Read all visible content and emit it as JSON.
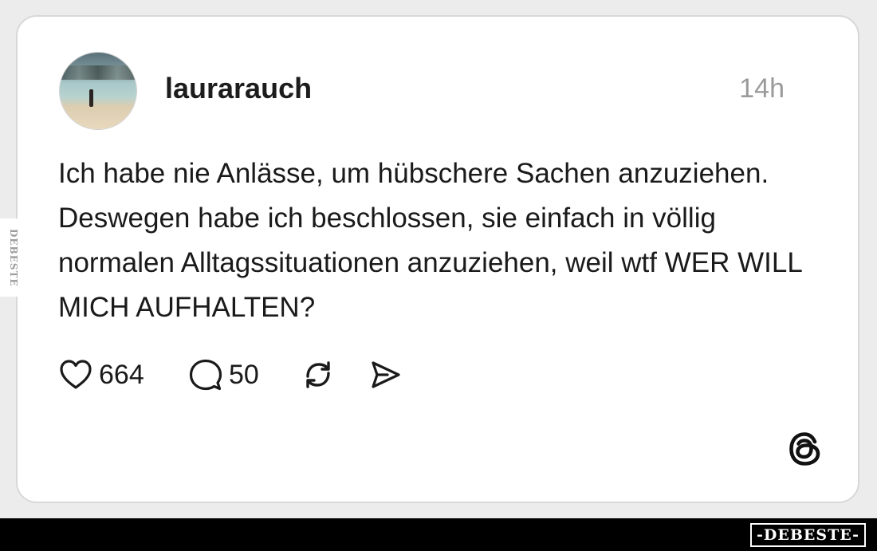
{
  "post": {
    "username": "laurarauch",
    "time": "14h",
    "text": "Ich habe nie Anlässe, um hübschere Sachen anzuziehen. Deswegen habe ich beschlossen, sie einfach in völlig normalen Alltagssituationen anzuziehen, weil wtf WER WILL MICH AUFHALTEN?",
    "likes": "664",
    "comments": "50"
  },
  "icons": {
    "like": "heart-icon",
    "comment": "speech-bubble-icon",
    "repost": "repost-icon",
    "share": "send-icon",
    "brand": "threads-logo-icon"
  },
  "watermark": {
    "side": "DEBESTE",
    "footer": "-DEBESTE-"
  },
  "colors": {
    "card_background": "#ffffff",
    "page_background": "#ececec",
    "text": "#1a1a1a",
    "timestamp": "#9a9a9a",
    "footer_bar": "#000000"
  }
}
